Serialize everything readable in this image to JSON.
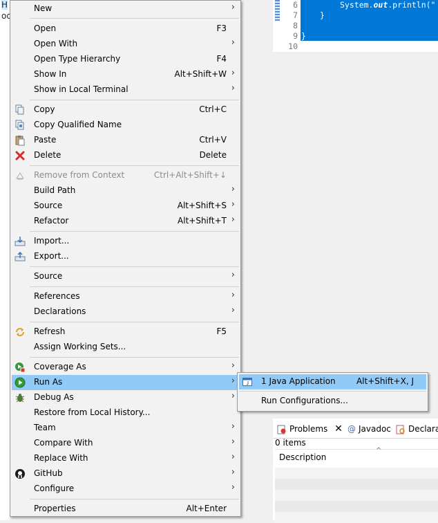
{
  "background": {
    "left_fragments": [
      "H",
      "od"
    ]
  },
  "editor": {
    "line_numbers": [
      "6",
      "7",
      "8",
      "9",
      "10"
    ],
    "code": {
      "line6_pre": "System.",
      "line6_field": "out",
      "line6_post": ".println(\"",
      "line7": "}",
      "line9": "}"
    }
  },
  "context_menu": {
    "items": {
      "new": {
        "label": "New"
      },
      "open": {
        "label": "Open",
        "shortcut": "F3"
      },
      "open_with": {
        "label": "Open With"
      },
      "open_type_hierarchy": {
        "label": "Open Type Hierarchy",
        "shortcut": "F4"
      },
      "show_in": {
        "label": "Show In",
        "shortcut": "Alt+Shift+W"
      },
      "show_in_local_terminal": {
        "label": "Show in Local Terminal"
      },
      "copy": {
        "label": "Copy",
        "shortcut": "Ctrl+C"
      },
      "copy_qualified_name": {
        "label": "Copy Qualified Name"
      },
      "paste": {
        "label": "Paste",
        "shortcut": "Ctrl+V"
      },
      "delete": {
        "label": "Delete",
        "shortcut": "Delete"
      },
      "remove_from_context": {
        "label": "Remove from Context",
        "shortcut": "Ctrl+Alt+Shift+↓"
      },
      "build_path": {
        "label": "Build Path"
      },
      "source_1": {
        "label": "Source",
        "shortcut": "Alt+Shift+S"
      },
      "refactor": {
        "label": "Refactor",
        "shortcut": "Alt+Shift+T"
      },
      "import": {
        "label": "Import..."
      },
      "export": {
        "label": "Export..."
      },
      "source_2": {
        "label": "Source"
      },
      "references": {
        "label": "References"
      },
      "declarations": {
        "label": "Declarations"
      },
      "refresh": {
        "label": "Refresh",
        "shortcut": "F5"
      },
      "assign_working_sets": {
        "label": "Assign Working Sets..."
      },
      "coverage_as": {
        "label": "Coverage As"
      },
      "run_as": {
        "label": "Run As"
      },
      "debug_as": {
        "label": "Debug As"
      },
      "restore_from_local_history": {
        "label": "Restore from Local History..."
      },
      "team": {
        "label": "Team"
      },
      "compare_with": {
        "label": "Compare With"
      },
      "replace_with": {
        "label": "Replace With"
      },
      "github": {
        "label": "GitHub"
      },
      "configure": {
        "label": "Configure"
      },
      "properties": {
        "label": "Properties",
        "shortcut": "Alt+Enter"
      }
    },
    "arrow": "›"
  },
  "submenu": {
    "java_application": {
      "label": "1 Java Application",
      "shortcut": "Alt+Shift+X, J"
    },
    "run_configurations": {
      "label": "Run Configurations..."
    }
  },
  "problems_view": {
    "tabs": {
      "problems": "Problems",
      "javadoc": "Javadoc",
      "declaration": "Declarati"
    },
    "count": "0 items",
    "column_header": "Description"
  },
  "colors": {
    "menu_bg": "#f2f2f2",
    "menu_highlight": "#91c9f7",
    "editor_selection": "#0078d7",
    "disabled_text": "#8c8c8c"
  }
}
